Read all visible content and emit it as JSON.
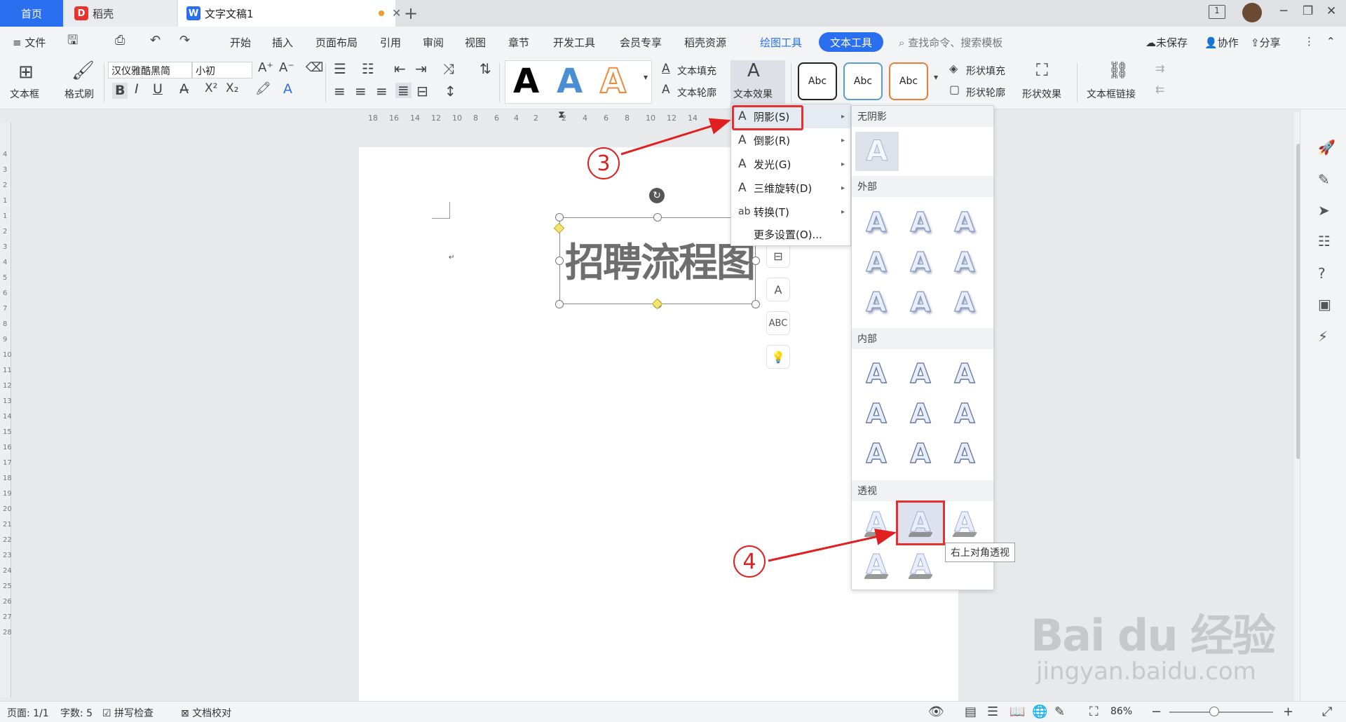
{
  "tabs": {
    "home": "首页",
    "docer": "稻壳",
    "docer_logo": "D",
    "document": "文字文稿1",
    "doc_logo": "W",
    "new_tab": "+"
  },
  "window_controls": {
    "tab_count": "1",
    "minimize": "─",
    "restore": "❐",
    "close": "✕"
  },
  "menu": {
    "file": "≡ 文件",
    "items": [
      "开始",
      "插入",
      "页面布局",
      "引用",
      "审阅",
      "视图",
      "章节",
      "开发工具",
      "会员专享",
      "稻壳资源"
    ],
    "drawing_tools": "绘图工具",
    "text_tools": "文本工具",
    "search": "查找命令、搜索模板",
    "unsaved": "未保存",
    "collaborate": "协作",
    "share": "分享"
  },
  "ribbon": {
    "textbox": "文本框",
    "format_painter": "格式刷",
    "font_name": "汉仪雅酷黑简",
    "font_size": "小初",
    "text_fill": "文本填充",
    "text_outline": "文本轮廓",
    "text_effect": "文本效果",
    "abc_label": "Abc",
    "shape_fill": "形状填充",
    "shape_outline": "形状轮廓",
    "shape_effect": "形状效果",
    "textbox_link": "文本框链接",
    "style_colors": [
      "#000000",
      "#4a8fd4",
      "#f08a3a"
    ],
    "style_box_borders": [
      "#222222",
      "#5b9bd5",
      "#ed7d31"
    ]
  },
  "ruler": {
    "marks": [
      "18",
      "16",
      "14",
      "12",
      "10",
      "8",
      "6",
      "4",
      "2",
      "2",
      "4",
      "6",
      "8",
      "10",
      "12",
      "14"
    ],
    "vertical": [
      "4",
      "3",
      "2",
      "1",
      "1",
      "2",
      "3",
      "4",
      "5",
      "6",
      "7",
      "8",
      "9",
      "10",
      "11",
      "12",
      "13",
      "14",
      "15",
      "16",
      "17",
      "18",
      "19",
      "20",
      "21",
      "22",
      "23",
      "24",
      "25",
      "26",
      "27",
      "28"
    ]
  },
  "document": {
    "wordart_text": "招聘流程图",
    "paragraph_mark": "↵"
  },
  "effect_menu": {
    "items": [
      {
        "label": "阴影(S)",
        "icon": "A",
        "submenu": true
      },
      {
        "label": "倒影(R)",
        "icon": "A",
        "submenu": true
      },
      {
        "label": "发光(G)",
        "icon": "A",
        "submenu": true
      },
      {
        "label": "三维旋转(D)",
        "icon": "A",
        "submenu": true
      },
      {
        "label": "转换(T)",
        "icon": "ab",
        "submenu": true
      },
      {
        "label": "更多设置(O)...",
        "icon": "",
        "submenu": false
      }
    ]
  },
  "shadow_gallery": {
    "no_shadow": "无阴影",
    "outer": "外部",
    "inner": "内部",
    "perspective": "透视",
    "glyph": "A",
    "selected_tooltip": "右上对角透视"
  },
  "annotations": {
    "step3": "3",
    "step4": "4",
    "color": "#e02020"
  },
  "statusbar": {
    "page": "页面: 1/1",
    "word_count": "字数: 5",
    "spell_check": "拼写检查",
    "doc_proof": "文档校对",
    "zoom": "86%",
    "zoom_level": 0.43
  },
  "watermark": {
    "brand": "Bai du 经验",
    "url": "jingyan.baidu.com"
  }
}
